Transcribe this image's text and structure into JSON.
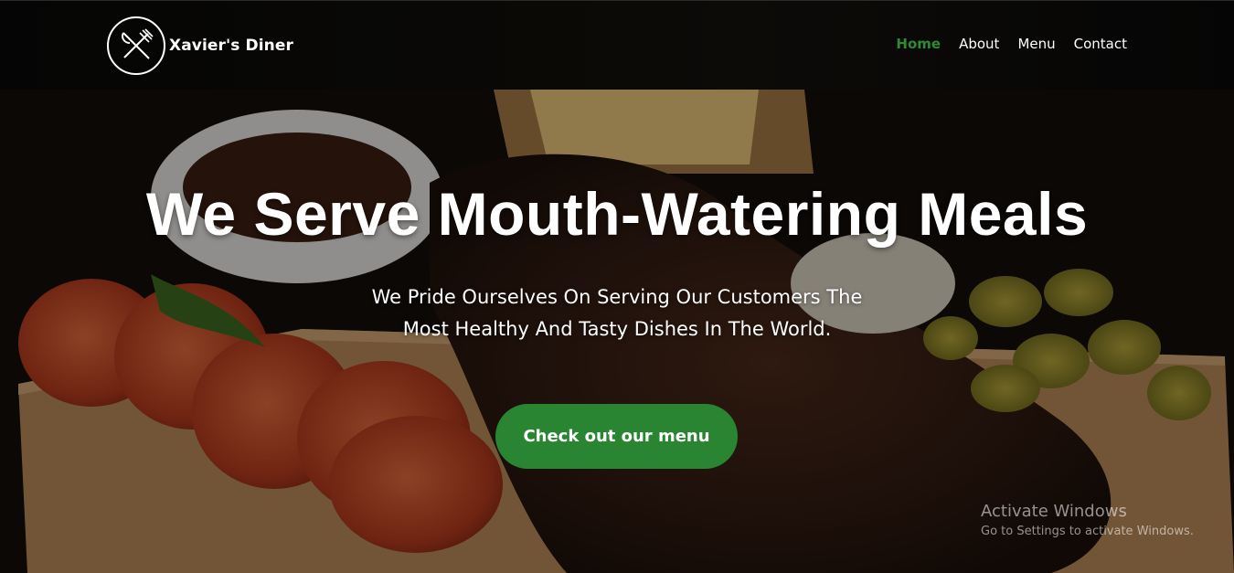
{
  "brand": {
    "name": "Xavier's Diner",
    "logo_icon": "fork-knife-icon"
  },
  "nav": {
    "items": [
      {
        "label": "Home",
        "active": true
      },
      {
        "label": "About",
        "active": false
      },
      {
        "label": "Menu",
        "active": false
      },
      {
        "label": "Contact",
        "active": false
      }
    ]
  },
  "hero": {
    "title": "We Serve Mouth-Watering Meals",
    "subtitle_line1": "We Pride Ourselves On Serving Our Customers The",
    "subtitle_line2": "Most Healthy And Tasty Dishes In The World.",
    "cta_label": "Check out our menu"
  },
  "watermark": {
    "title": "Activate Windows",
    "subtitle": "Go to Settings to activate Windows."
  },
  "colors": {
    "accent": "#2a8532",
    "active_nav": "#2e8b34",
    "nav_bg": "#050505"
  }
}
